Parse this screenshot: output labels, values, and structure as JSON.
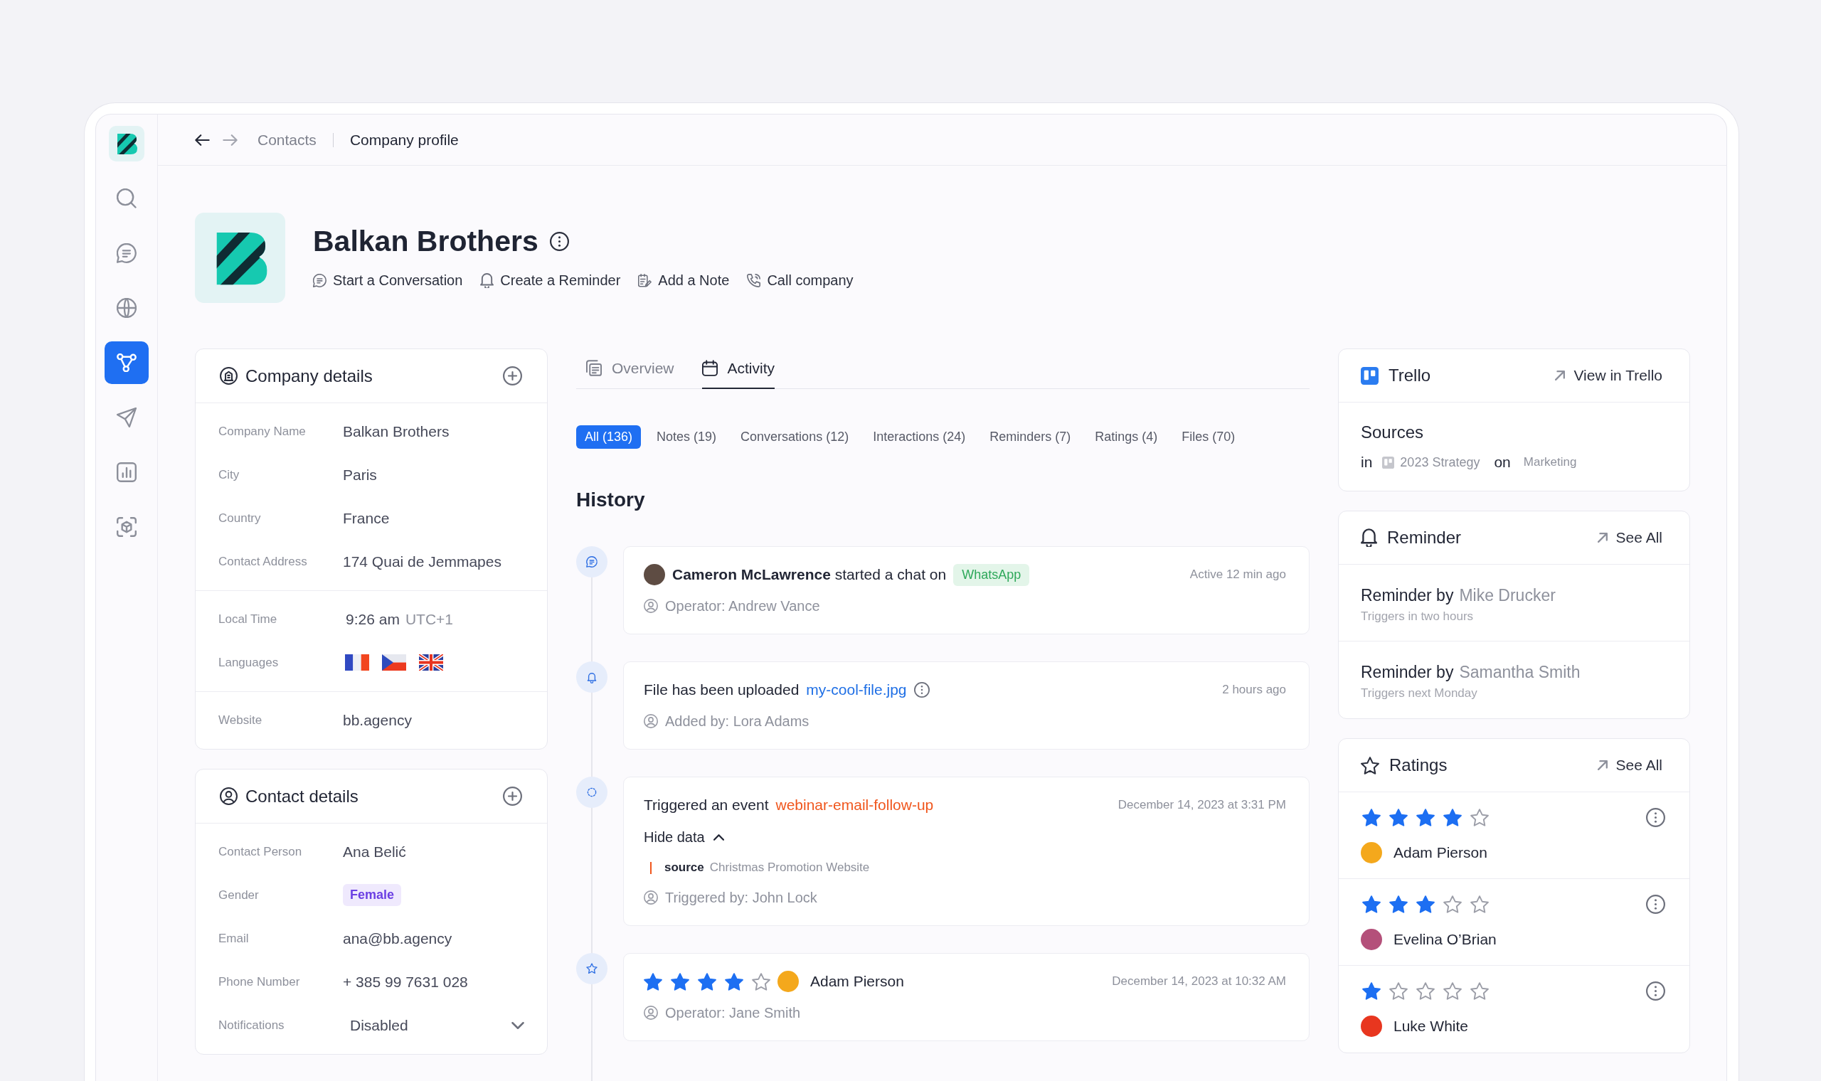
{
  "sidebar": {
    "items": [
      {
        "selected": false
      },
      {
        "selected": false
      },
      {
        "selected": false
      },
      {
        "selected": true
      },
      {
        "selected": false
      },
      {
        "selected": false
      },
      {
        "selected": false
      }
    ]
  },
  "breadcrumbs": {
    "back": {
      "disabled": false
    },
    "forward": {
      "disabled": true
    },
    "items": [
      {
        "label": "Contacts",
        "current": false
      },
      {
        "label": "Company profile",
        "current": true
      }
    ]
  },
  "company": {
    "name": "Balkan Brothers",
    "actions": [
      {
        "label": "Start a Conversation"
      },
      {
        "label": "Create a Reminder"
      },
      {
        "label": "Add a Note"
      },
      {
        "label": "Call company"
      }
    ]
  },
  "company_details": {
    "title": "Company details",
    "groups": [
      {
        "rows": [
          {
            "kind": "text",
            "label": "Company Name",
            "value": "Balkan Brothers"
          },
          {
            "kind": "text",
            "label": "City",
            "value": "Paris"
          },
          {
            "kind": "text",
            "label": "Country",
            "value": "France"
          },
          {
            "kind": "text",
            "label": "Contact Address",
            "value": "174 Quai de Jemmapes"
          }
        ]
      },
      {
        "rows": [
          {
            "kind": "time",
            "label": "Local Time",
            "value": "9:26 am",
            "zone": "UTC+1"
          },
          {
            "kind": "flags",
            "label": "Languages"
          }
        ]
      },
      {
        "rows": [
          {
            "kind": "text",
            "label": "Website",
            "value": "bb.agency"
          }
        ]
      }
    ]
  },
  "contact_details": {
    "title": "Contact details",
    "groups": [
      {
        "rows": [
          {
            "kind": "text",
            "label": "Contact Person",
            "value": "Ana Belić"
          },
          {
            "kind": "badge",
            "label": "Gender",
            "value": "Female"
          },
          {
            "kind": "text",
            "label": "Email",
            "value": "ana@bb.agency"
          },
          {
            "kind": "text",
            "label": "Phone Number",
            "value": "+ 385 99 7631 028"
          },
          {
            "kind": "select",
            "label": "Notifications",
            "value": "Disabled"
          }
        ]
      }
    ]
  },
  "tabs": [
    {
      "label": "Overview",
      "selected": false
    },
    {
      "label": "Activity",
      "selected": true
    }
  ],
  "filters": [
    {
      "label": "All (136)",
      "selected": true
    },
    {
      "label": "Notes (19)",
      "selected": false
    },
    {
      "label": "Conversations (12)",
      "selected": false
    },
    {
      "label": "Interactions (24)",
      "selected": false
    },
    {
      "label": "Reminders (7)",
      "selected": false
    },
    {
      "label": "Ratings (4)",
      "selected": false
    },
    {
      "label": "Files (70)",
      "selected": false
    }
  ],
  "history": {
    "title": "History",
    "entries": [
      {
        "kind": "chat",
        "color": "#5e4c43",
        "text": "**Cameron McLawrence** started a chat on",
        "channel": "WhatsApp",
        "time": "Active 12 min ago",
        "meta": "Operator: Andrew Vance"
      },
      {
        "kind": "file",
        "text": "File has been uploaded",
        "file": "my-cool-file.jpg",
        "time": "2 hours ago",
        "meta": "Added by: Lora Adams"
      },
      {
        "kind": "event",
        "text": "Triggered an event",
        "event": "webinar-email-follow-up",
        "time": "December 14, 2023 at 3:31 PM",
        "toggle": "Hide data",
        "expanded": true,
        "data": [
          {
            "key": "source",
            "value": "Christmas Promotion Website"
          }
        ],
        "meta": "Triggered by: John Lock"
      },
      {
        "kind": "rating",
        "stars": 4,
        "color": "#f4a81c",
        "person": "Adam Pierson",
        "time": "December 14, 2023 at 10:32 AM",
        "meta": "Operator: Jane Smith"
      }
    ]
  },
  "trello": {
    "title": "Trello",
    "link": "View in Trello",
    "item": "Sources",
    "in_label": "in",
    "list": "2023 Strategy",
    "on_label": "on",
    "board": "Marketing"
  },
  "reminders": {
    "title": "Reminder",
    "link": "See All",
    "items": [
      {
        "label": "Reminder by",
        "author": "Mike Drucker",
        "when": "Triggers in two hours"
      },
      {
        "label": "Reminder by",
        "author": "Samantha Smith",
        "when": "Triggers next Monday"
      }
    ]
  },
  "ratings": {
    "title": "Ratings",
    "link": "See All",
    "items": [
      {
        "stars": 4,
        "color": "#f4a81c",
        "person": "Adam Pierson"
      },
      {
        "stars": 3,
        "color": "#b4507a",
        "person": "Evelina O’Brian"
      },
      {
        "stars": 1,
        "color": "#e8361f",
        "person": "Luke White"
      }
    ]
  }
}
